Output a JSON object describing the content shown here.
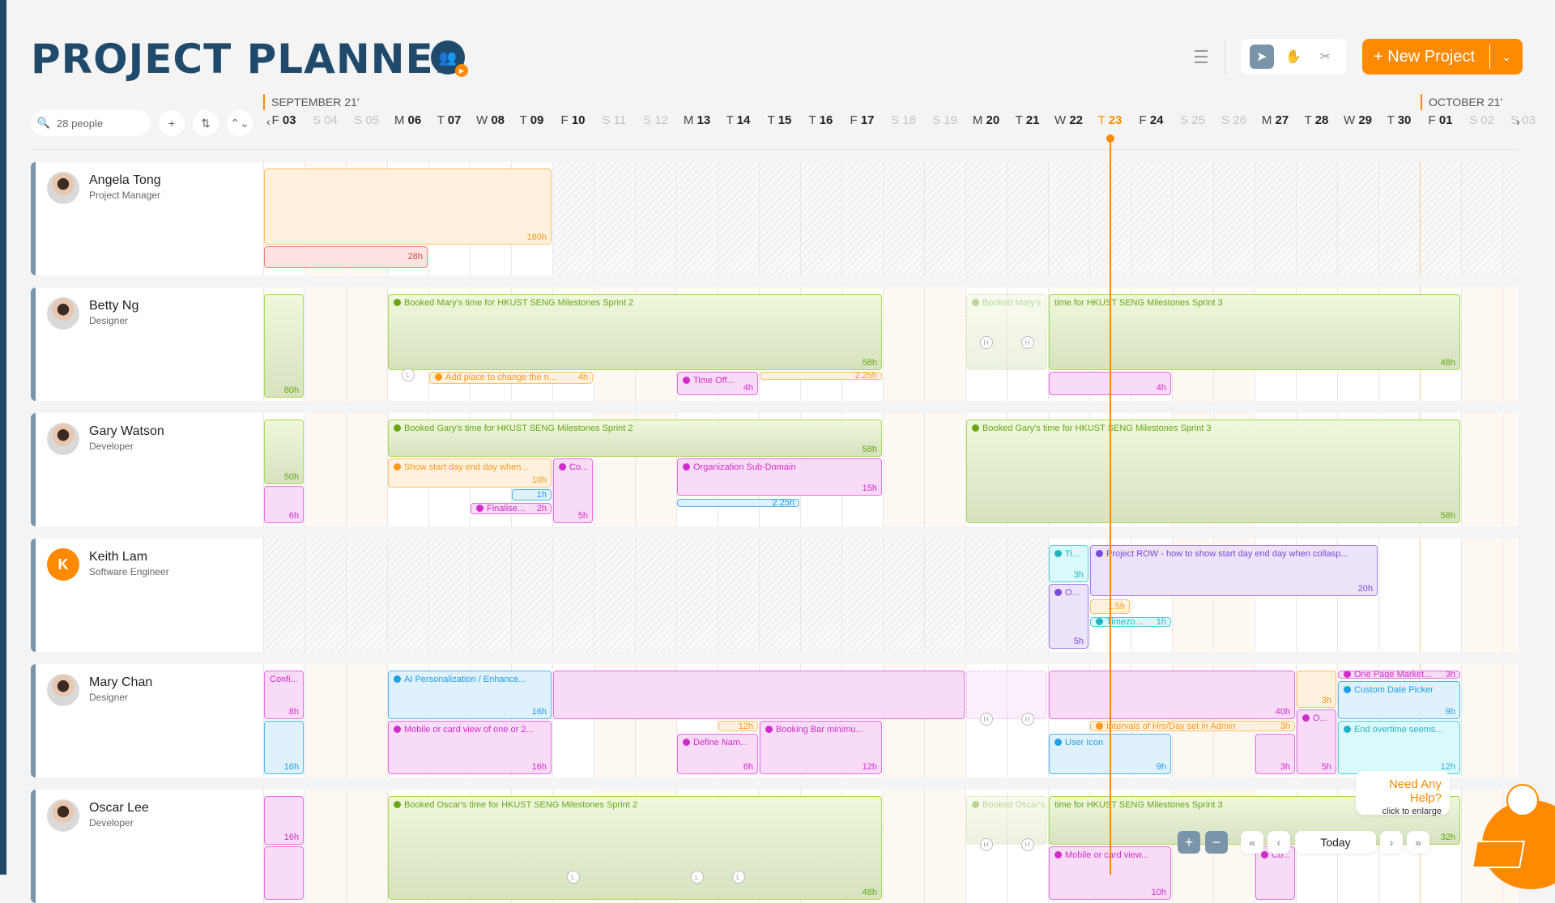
{
  "header": {
    "title": "PROJECT PLANNER",
    "team_icon": "team-icon",
    "list_view_icon": "list-icon",
    "tools": [
      {
        "name": "select",
        "icon": "cursor-icon",
        "active": true
      },
      {
        "name": "pan",
        "icon": "hand-icon",
        "active": false
      },
      {
        "name": "split",
        "icon": "scissors-icon",
        "active": false
      }
    ],
    "new_project_label": "+ New Project",
    "new_project_caret": "⌄"
  },
  "controls": {
    "search_placeholder": "",
    "search_value": "28 people",
    "add_label": "+",
    "sort_label": "⇅",
    "collapse_label": "⌃⌄"
  },
  "timeline": {
    "months": [
      {
        "label": "SEPTEMBER 21'"
      },
      {
        "label": "OCTOBER 21'"
      }
    ],
    "prev_arrow": "‹",
    "next_arrow": "›",
    "days": [
      {
        "l": "F",
        "n": "03",
        "type": "weekday"
      },
      {
        "l": "S",
        "n": "04",
        "type": "weekend"
      },
      {
        "l": "S",
        "n": "05",
        "type": "weekend"
      },
      {
        "l": "M",
        "n": "06",
        "type": "weekday"
      },
      {
        "l": "T",
        "n": "07",
        "type": "weekday"
      },
      {
        "l": "W",
        "n": "08",
        "type": "weekday"
      },
      {
        "l": "T",
        "n": "09",
        "type": "weekday"
      },
      {
        "l": "F",
        "n": "10",
        "type": "weekday"
      },
      {
        "l": "S",
        "n": "11",
        "type": "weekend"
      },
      {
        "l": "S",
        "n": "12",
        "type": "weekend"
      },
      {
        "l": "M",
        "n": "13",
        "type": "weekday"
      },
      {
        "l": "T",
        "n": "14",
        "type": "weekday"
      },
      {
        "l": "T",
        "n": "15",
        "type": "weekday"
      },
      {
        "l": "T",
        "n": "16",
        "type": "weekday"
      },
      {
        "l": "F",
        "n": "17",
        "type": "weekday"
      },
      {
        "l": "S",
        "n": "18",
        "type": "weekend"
      },
      {
        "l": "S",
        "n": "19",
        "type": "weekend"
      },
      {
        "l": "M",
        "n": "20",
        "type": "weekday"
      },
      {
        "l": "T",
        "n": "21",
        "type": "weekday"
      },
      {
        "l": "W",
        "n": "22",
        "type": "weekday"
      },
      {
        "l": "T",
        "n": "23",
        "type": "today"
      },
      {
        "l": "F",
        "n": "24",
        "type": "weekday"
      },
      {
        "l": "S",
        "n": "25",
        "type": "weekend"
      },
      {
        "l": "S",
        "n": "26",
        "type": "weekend"
      },
      {
        "l": "M",
        "n": "27",
        "type": "weekday"
      },
      {
        "l": "T",
        "n": "28",
        "type": "weekday"
      },
      {
        "l": "W",
        "n": "29",
        "type": "weekday"
      },
      {
        "l": "T",
        "n": "30",
        "type": "weekday"
      },
      {
        "l": "F",
        "n": "01",
        "type": "weekday"
      },
      {
        "l": "S",
        "n": "02",
        "type": "weekend"
      },
      {
        "l": "S",
        "n": "03",
        "type": "weekend"
      }
    ]
  },
  "people": [
    {
      "name": "Angela Tong",
      "role": "Project Manager",
      "avatar": "photo",
      "unavailable_from_day": 7,
      "bars": [
        {
          "color": "orange",
          "start": 0,
          "span": 7,
          "lane": 0,
          "lanes": 2,
          "title": "",
          "hours": "180h"
        },
        {
          "color": "red",
          "start": 0,
          "span": 4,
          "lane": 2,
          "lanes": 0.6,
          "title": "",
          "hours": "28h",
          "inline": true
        }
      ],
      "marks": []
    },
    {
      "name": "Betty Ng",
      "role": "Designer",
      "avatar": "photo",
      "bars": [
        {
          "color": "green",
          "start": 0,
          "span": 1,
          "lane": 0,
          "lanes": 2.7,
          "title": "",
          "hours": "80h"
        },
        {
          "color": "green",
          "start": 3,
          "span": 12,
          "lane": 0,
          "lanes": 2,
          "title": "Booked Mary's time for HKUST SENG Milestones Sprint 2",
          "hours": "58h",
          "comment": true
        },
        {
          "color": "orange",
          "start": 4,
          "span": 4,
          "lane": 2,
          "lanes": 0.35,
          "title": "Add place to change the n...",
          "hours": "4h",
          "inline": true,
          "comment": true
        },
        {
          "color": "pink",
          "start": 10,
          "span": 2,
          "lane": 2,
          "lanes": 0.65,
          "title": "Time Off...",
          "hours": "4h",
          "comment": true
        },
        {
          "color": "orange",
          "start": 12,
          "span": 3,
          "lane": 2,
          "lanes": 0.25,
          "title": "",
          "hours": "2.25h",
          "inline": true
        },
        {
          "color": "green",
          "start": 17,
          "span": 2,
          "lane": 0,
          "lanes": 2,
          "title": "Booked Mary's",
          "hours": "",
          "ghost": true,
          "comment": true
        },
        {
          "color": "green",
          "start": 19,
          "span": 10,
          "lane": 0,
          "lanes": 2,
          "title": "time for HKUST SENG Milestones Sprint 3",
          "hours": "48h"
        },
        {
          "color": "pink",
          "start": 19,
          "span": 3,
          "lane": 2,
          "lanes": 0.65,
          "title": "",
          "hours": "4h"
        }
      ],
      "marks": [
        {
          "day": 3,
          "label": "L"
        },
        {
          "day": 17,
          "label": "H"
        },
        {
          "day": 18,
          "label": "H"
        }
      ]
    },
    {
      "name": "Gary Watson",
      "role": "Developer",
      "avatar": "photo",
      "bars": [
        {
          "color": "green",
          "start": 0,
          "span": 1,
          "lane": 0,
          "lanes": 1.7,
          "title": "",
          "hours": "50h"
        },
        {
          "color": "pink",
          "start": 0,
          "span": 1,
          "lane": 1.7,
          "lanes": 1,
          "title": "",
          "hours": "6h"
        },
        {
          "color": "green",
          "start": 3,
          "span": 12,
          "lane": 0,
          "lanes": 1,
          "title": "Booked Gary's time for HKUST SENG Milestones Sprint 2",
          "hours": "58h",
          "comment": true
        },
        {
          "color": "orange",
          "start": 3,
          "span": 4,
          "lane": 1,
          "lanes": 0.8,
          "title": "Show start day end day when...",
          "hours": "10h",
          "comment": true
        },
        {
          "color": "blue",
          "start": 6,
          "span": 1,
          "lane": 1.8,
          "lanes": 0.32,
          "title": "",
          "hours": "1h",
          "inline": true
        },
        {
          "color": "pink",
          "start": 5,
          "span": 2,
          "lane": 2.15,
          "lanes": 0.32,
          "title": "Finalise...",
          "hours": "2h",
          "inline": true,
          "comment": true
        },
        {
          "color": "pink",
          "start": 7,
          "span": 1,
          "lane": 1,
          "lanes": 1.7,
          "title": "Co...",
          "hours": "5h",
          "comment": true
        },
        {
          "color": "pink",
          "start": 10,
          "span": 5,
          "lane": 1,
          "lanes": 1,
          "title": "Organization Sub-Domain",
          "hours": "15h",
          "comment": true
        },
        {
          "color": "blue",
          "start": 10,
          "span": 3,
          "lane": 2.05,
          "lanes": 0.25,
          "title": "",
          "hours": "2.25h",
          "inline": true
        },
        {
          "color": "green",
          "start": 17,
          "span": 12,
          "lane": 0,
          "lanes": 2.7,
          "title": "Booked Gary's time for HKUST SENG Milestones Sprint 3",
          "hours": "58h",
          "comment": true
        }
      ],
      "marks": []
    },
    {
      "name": "Keith Lam",
      "role": "Software Engineer",
      "avatar": "initial",
      "initial": "K",
      "unavailable_until_day": 19,
      "bars": [
        {
          "color": "cyan",
          "start": 19,
          "span": 1,
          "lane": 0,
          "lanes": 1,
          "title": "Ti...",
          "hours": "3h",
          "comment": true
        },
        {
          "color": "purple",
          "start": 19,
          "span": 1,
          "lane": 1,
          "lanes": 1.7,
          "title": "O...",
          "hours": "5h",
          "comment": true
        },
        {
          "color": "purple",
          "start": 20,
          "span": 7,
          "lane": 0,
          "lanes": 1.35,
          "title": "Project ROW - how to show start day end day when collasp...",
          "hours": "20h",
          "comment": true
        },
        {
          "color": "orange",
          "start": 20,
          "span": 1,
          "lane": 1.4,
          "lanes": 0.42,
          "title": "",
          "hours": "1.5h",
          "inline": true
        },
        {
          "color": "cyan",
          "start": 20,
          "span": 2,
          "lane": 1.85,
          "lanes": 0.3,
          "title": "Timezo...",
          "hours": "1h",
          "inline": true,
          "comment": true
        }
      ],
      "marks": []
    },
    {
      "name": "Mary Chan",
      "role": "Designer",
      "avatar": "photo",
      "bars": [
        {
          "color": "pink",
          "start": 0,
          "span": 1,
          "lane": 0,
          "lanes": 1.3,
          "title": "Confi...",
          "hours": "8h"
        },
        {
          "color": "blue",
          "start": 0,
          "span": 1,
          "lane": 1.3,
          "lanes": 1.4,
          "title": "",
          "hours": "16h"
        },
        {
          "color": "blue",
          "start": 3,
          "span": 4,
          "lane": 0,
          "lanes": 1.3,
          "title": "AI Personalization / Enhance...",
          "hours": "16h",
          "comment": true
        },
        {
          "color": "pink",
          "start": 7,
          "span": 10,
          "lane": 0,
          "lanes": 1.3,
          "title": "",
          "hours": ""
        },
        {
          "color": "pink",
          "start": 17,
          "span": 2,
          "lane": 0,
          "lanes": 1.3,
          "title": "",
          "hours": "",
          "ghost": true
        },
        {
          "color": "pink",
          "start": 19,
          "span": 6,
          "lane": 0,
          "lanes": 1.3,
          "title": "",
          "hours": "40h"
        },
        {
          "color": "pink",
          "start": 3,
          "span": 4,
          "lane": 1.3,
          "lanes": 1.4,
          "title": "Mobile or card view of one or 2...",
          "hours": "16h",
          "comment": true
        },
        {
          "color": "orange",
          "start": 11,
          "span": 1,
          "lane": 1.3,
          "lanes": 0.3,
          "title": "",
          "hours": "12h",
          "inline": true
        },
        {
          "color": "pink",
          "start": 10,
          "span": 2,
          "lane": 1.62,
          "lanes": 1.08,
          "title": "Define Nam...",
          "hours": "6h",
          "comment": true
        },
        {
          "color": "pink",
          "start": 12,
          "span": 3,
          "lane": 1.3,
          "lanes": 1.4,
          "title": "Booking Bar minimu...",
          "hours": "12h",
          "comment": true
        },
        {
          "color": "orange",
          "start": 20,
          "span": 5,
          "lane": 1.3,
          "lanes": 0.3,
          "title": "Intervals of Hrs/Day set in Admin",
          "hours": "3h",
          "inline": true,
          "comment": true
        },
        {
          "color": "blue",
          "start": 19,
          "span": 3,
          "lane": 1.62,
          "lanes": 1.08,
          "title": "User Icon",
          "hours": "9h",
          "comment": true
        },
        {
          "color": "pink",
          "start": 24,
          "span": 1,
          "lane": 1.62,
          "lanes": 1.08,
          "title": "",
          "hours": "3h"
        },
        {
          "color": "orange",
          "start": 25,
          "span": 1,
          "lane": 0,
          "lanes": 1.0,
          "title": "",
          "hours": "3h"
        },
        {
          "color": "pink",
          "start": 25,
          "span": 1,
          "lane": 1.0,
          "lanes": 1.7,
          "title": "O...",
          "hours": "5h",
          "comment": true
        },
        {
          "color": "pink",
          "start": 26,
          "span": 3,
          "lane": 0,
          "lanes": 0.25,
          "title": "One Page Market...",
          "hours": "3h",
          "inline": true,
          "comment": true
        },
        {
          "color": "blue",
          "start": 26,
          "span": 3,
          "lane": 0.27,
          "lanes": 1.03,
          "title": "Custom Date Picker",
          "hours": "9h",
          "comment": true
        },
        {
          "color": "cyan",
          "start": 26,
          "span": 3,
          "lane": 1.3,
          "lanes": 1.4,
          "title": "End overtime seems...",
          "hours": "12h",
          "comment": true
        }
      ],
      "marks": [
        {
          "day": 17,
          "label": "H"
        },
        {
          "day": 18,
          "label": "H"
        }
      ]
    },
    {
      "name": "Oscar Lee",
      "role": "Developer",
      "avatar": "photo",
      "bars": [
        {
          "color": "pink",
          "start": 0,
          "span": 1,
          "lane": 0,
          "lanes": 1.3,
          "title": "",
          "hours": "16h"
        },
        {
          "color": "pink",
          "start": 0,
          "span": 1,
          "lane": 1.3,
          "lanes": 1.4,
          "title": "",
          "hours": ""
        },
        {
          "color": "green",
          "start": 3,
          "span": 12,
          "lane": 0,
          "lanes": 2.7,
          "title": "Booked Oscar's time for HKUST SENG Milestones Sprint 2",
          "hours": "48h",
          "comment": true
        },
        {
          "color": "green",
          "start": 17,
          "span": 2,
          "lane": 0,
          "lanes": 1.3,
          "title": "Booked Oscar's",
          "hours": "",
          "ghost": true,
          "comment": true
        },
        {
          "color": "green",
          "start": 19,
          "span": 10,
          "lane": 0,
          "lanes": 1.3,
          "title": "time for HKUST SENG Milestones Sprint 3",
          "hours": "32h"
        },
        {
          "color": "pink",
          "start": 19,
          "span": 3,
          "lane": 1.3,
          "lanes": 1.4,
          "title": "Mobile or card view...",
          "hours": "10h",
          "comment": true
        },
        {
          "color": "pink",
          "start": 24,
          "span": 1,
          "lane": 1.3,
          "lanes": 1.4,
          "title": "Co...",
          "hours": "",
          "comment": true
        }
      ],
      "marks": [
        {
          "day": 7,
          "label": "L"
        },
        {
          "day": 10,
          "label": "L"
        },
        {
          "day": 11,
          "label": "L"
        },
        {
          "day": 17,
          "label": "H"
        },
        {
          "day": 18,
          "label": "H"
        }
      ]
    }
  ],
  "footer": {
    "zoom_in": "+",
    "zoom_out": "−",
    "first": "«",
    "prev": "‹",
    "today": "Today",
    "next": "›",
    "last": "»"
  },
  "help": {
    "title": "Need Any Help?",
    "subtitle": "click to enlarge"
  },
  "colors": {
    "brand": "#1f4a6b",
    "accent": "#ff8a00",
    "today": "#ff8a00"
  }
}
